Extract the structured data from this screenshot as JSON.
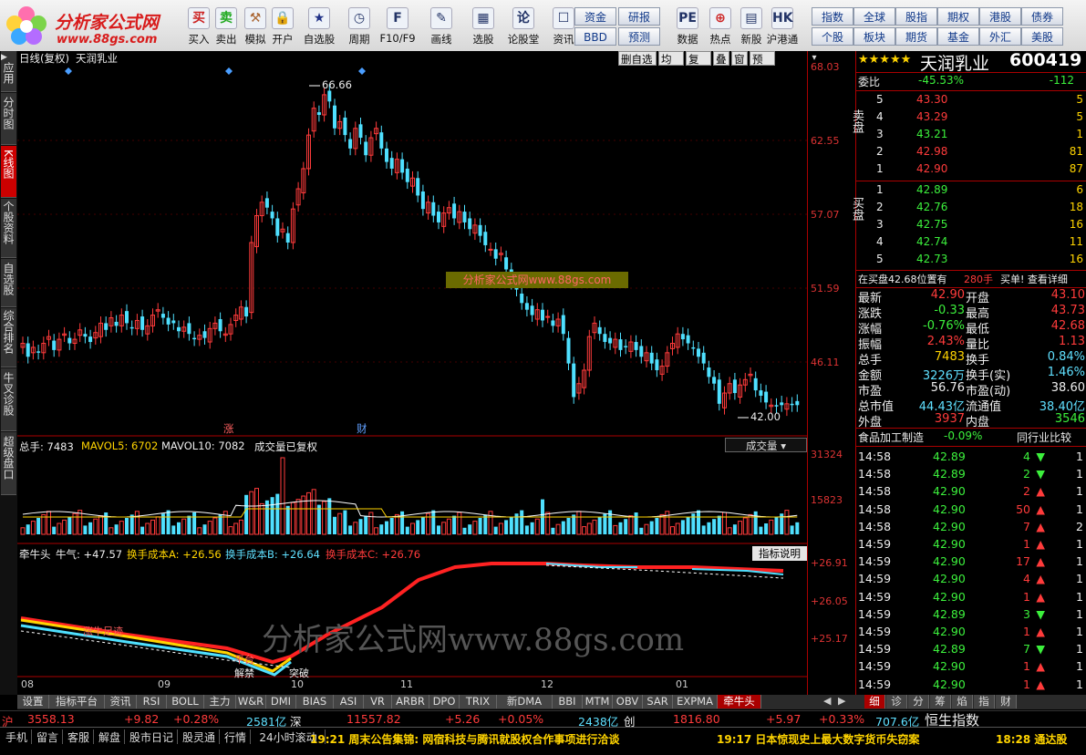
{
  "toolbar": {
    "brand": "分析家公式网",
    "url": "www.88gs.com",
    "buttons": [
      "买入",
      "卖出",
      "模拟",
      "开户",
      "自选股",
      "周期",
      "F10/F9",
      "画线",
      "选股",
      "论股堂",
      "资讯",
      "数据",
      "热点",
      "新股",
      "沪港通"
    ],
    "icon_glyphs": [
      "买",
      "卖",
      "⚒",
      "🔒",
      "★",
      "◷",
      "F",
      "✎",
      "▦",
      "论",
      "☐",
      "PE",
      "⊕",
      "▤",
      "HK"
    ],
    "grid_buttons_left": [
      "资金",
      "BBD",
      "研报",
      "预测"
    ],
    "grid_buttons_right": [
      "指数",
      "个股",
      "全球",
      "板块",
      "股指",
      "期货",
      "期权",
      "基金",
      "港股",
      "外汇",
      "债券",
      "美股"
    ]
  },
  "left_tabs": [
    "应用",
    "分时图",
    "K线图",
    "个股资料",
    "自选股",
    "综合排名",
    "牛叉诊股",
    "超级盘口"
  ],
  "chart": {
    "period_label": "日线(复权)",
    "stock_name": "天润乳业",
    "top_buttons": [
      "删自选",
      "均线",
      "复权",
      "叠",
      "窗",
      "预测"
    ],
    "y_labels": [
      "68.03",
      "62.55",
      "57.07",
      "51.59",
      "46.11"
    ],
    "annot_high": "66.66",
    "annot_low": "42.00",
    "marker_zhang": "涨",
    "marker_cai": "财",
    "watermark_small": "分析家公式网www.88gs.com",
    "watermark_big": "分析家公式网www.88gs.com",
    "vol_header": {
      "zongshou": "总手: 7483",
      "mavol5": "MAVOL5: 6702",
      "mavol10": "MAVOL10: 7082",
      "note": "成交量已复权",
      "dropdown": "成交量"
    },
    "vol_y": [
      "31324",
      "15823"
    ],
    "ind_header": {
      "name": "牵牛头",
      "niuqi": "牛气: +47.57",
      "a": "换手成本A: +26.56",
      "b": "换手成本B: +26.64",
      "c": "换手成本C: +26.76",
      "btn": "指标说明"
    },
    "ind_y": [
      "+26.91",
      "+26.05",
      "+25.17"
    ],
    "ind_labels": {
      "zuji": "涨牛足迹",
      "pingtai": "平台",
      "tupo": "突破",
      "jiebang": "解禁"
    },
    "x_labels": [
      "08",
      "09",
      "10",
      "11",
      "12",
      "01"
    ]
  },
  "panel": {
    "title": "天润乳业",
    "code": "600419",
    "weibi_label": "委比",
    "weibi": "-45.53%",
    "weicha": "-112",
    "sell_label": "卖盘",
    "buy_label": "买盘",
    "sell": [
      {
        "n": "5",
        "p": "43.30",
        "v": "5"
      },
      {
        "n": "4",
        "p": "43.29",
        "v": "5"
      },
      {
        "n": "3",
        "p": "43.21",
        "v": "1"
      },
      {
        "n": "2",
        "p": "42.98",
        "v": "81"
      },
      {
        "n": "1",
        "p": "42.90",
        "v": "87"
      }
    ],
    "buy": [
      {
        "n": "1",
        "p": "42.89",
        "v": "6"
      },
      {
        "n": "2",
        "p": "42.76",
        "v": "18"
      },
      {
        "n": "3",
        "p": "42.75",
        "v": "16"
      },
      {
        "n": "4",
        "p": "42.74",
        "v": "11"
      },
      {
        "n": "5",
        "p": "42.73",
        "v": "16"
      }
    ],
    "notice_a": "在买盘42.68位置有",
    "notice_b": "280手",
    "notice_c": "买单! 查看详细",
    "quotes": [
      {
        "l1": "最新",
        "v1": "42.90",
        "l2": "开盘",
        "v2": "43.10"
      },
      {
        "l1": "涨跌",
        "v1": "-0.33",
        "l2": "最高",
        "v2": "43.73"
      },
      {
        "l1": "涨幅",
        "v1": "-0.76%",
        "l2": "最低",
        "v2": "42.68"
      },
      {
        "l1": "振幅",
        "v1": "2.43%",
        "l2": "量比",
        "v2": "1.13"
      },
      {
        "l1": "总手",
        "v1": "7483",
        "l2": "换手",
        "v2": "0.84%"
      },
      {
        "l1": "金额",
        "v1": "3226万",
        "l2": "换手(实)",
        "v2": "1.46%"
      },
      {
        "l1": "市盈",
        "v1": "56.76",
        "l2": "市盈(动)",
        "v2": "38.60"
      },
      {
        "l1": "总市值",
        "v1": "44.43亿",
        "l2": "流通值",
        "v2": "38.40亿"
      },
      {
        "l1": "外盘",
        "v1": "3937",
        "l2": "内盘",
        "v2": "3546"
      }
    ],
    "industry": "食品加工制造",
    "industry_pct": "-0.09%",
    "compare": "同行业比较",
    "ticks": [
      {
        "t": "14:58",
        "p": "42.89",
        "v": "4",
        "d": "down",
        "n": "1"
      },
      {
        "t": "14:58",
        "p": "42.89",
        "v": "2",
        "d": "down",
        "n": "1"
      },
      {
        "t": "14:58",
        "p": "42.90",
        "v": "2",
        "d": "up",
        "n": "1"
      },
      {
        "t": "14:58",
        "p": "42.90",
        "v": "50",
        "d": "up",
        "n": "1"
      },
      {
        "t": "14:58",
        "p": "42.90",
        "v": "7",
        "d": "up",
        "n": "2"
      },
      {
        "t": "14:59",
        "p": "42.90",
        "v": "1",
        "d": "up",
        "n": "1"
      },
      {
        "t": "14:59",
        "p": "42.90",
        "v": "17",
        "d": "up",
        "n": "1"
      },
      {
        "t": "14:59",
        "p": "42.90",
        "v": "4",
        "d": "up",
        "n": "1"
      },
      {
        "t": "14:59",
        "p": "42.90",
        "v": "1",
        "d": "up",
        "n": "1"
      },
      {
        "t": "14:59",
        "p": "42.89",
        "v": "3",
        "d": "down",
        "n": "1"
      },
      {
        "t": "14:59",
        "p": "42.90",
        "v": "1",
        "d": "up",
        "n": "1"
      },
      {
        "t": "14:59",
        "p": "42.89",
        "v": "7",
        "d": "down",
        "n": "1"
      },
      {
        "t": "14:59",
        "p": "42.90",
        "v": "1",
        "d": "up",
        "n": "1"
      },
      {
        "t": "14:59",
        "p": "42.90",
        "v": "1",
        "d": "up",
        "n": "1"
      }
    ],
    "bottom_tabs": [
      "细",
      "诊",
      "分",
      "筹",
      "焰",
      "指",
      "财"
    ]
  },
  "bottom_tabs": [
    "设置",
    "指标平台",
    "资讯",
    "RSI",
    "BOLL",
    "主力",
    "W&R",
    "DMI",
    "BIAS",
    "ASI",
    "VR",
    "ARBR",
    "DPO",
    "TRIX",
    "新DMA",
    "BBI",
    "MTM",
    "OBV",
    "SAR",
    "EXPMA",
    "牵牛头"
  ],
  "index_bar": {
    "sh_label": "沪",
    "sh": "3558.13",
    "sh_ch": "+9.82",
    "sh_pct": "+0.28%",
    "sh_amt": "2581亿",
    "sz_label": "深",
    "sz": "11557.82",
    "sz_ch": "+5.26",
    "sz_pct": "+0.05%",
    "sz_amt": "2438亿",
    "cy_label": "创",
    "cy": "1816.80",
    "cy_ch": "+5.97",
    "cy_pct": "+0.33%",
    "cy_amt": "707.6亿",
    "hs_label": "恒生指数"
  },
  "status": {
    "buttons": [
      "手机",
      "留言",
      "客服",
      "解盘",
      "股市日记",
      "股灵通",
      "行情",
      "24小时滚动"
    ],
    "news1": "19:21 周末公告集锦: 网宿科技与腾讯就股权合作事项进行洽谈",
    "news2": "19:17 日本惊现史上最大数字货币失窃案",
    "news3": "18:28 通达股"
  },
  "colors": {
    "up": "#ff3b3b",
    "down": "#3cf03c",
    "cyan_candle": "#4fe0ff",
    "axis": "#aa0000"
  }
}
